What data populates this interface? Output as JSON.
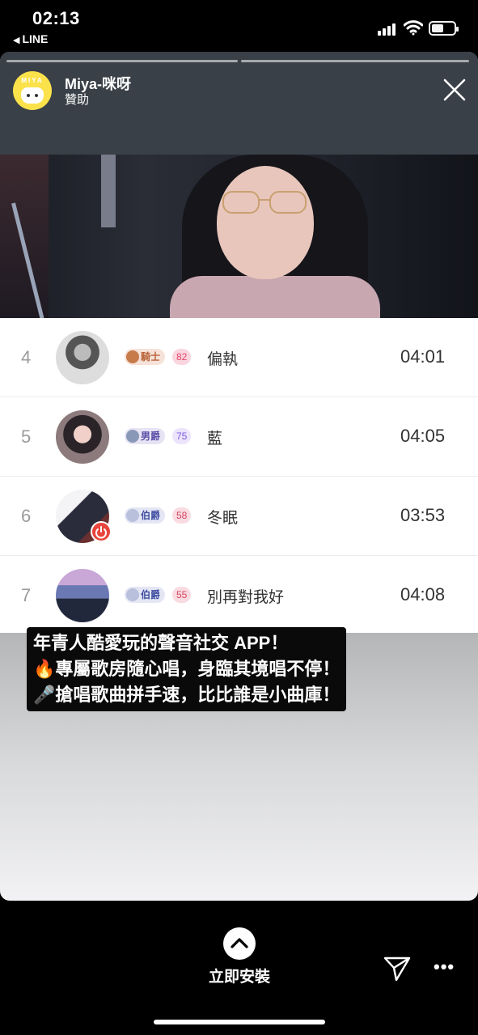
{
  "status_bar": {
    "time": "02:13",
    "back_app": "LINE"
  },
  "story": {
    "account_name": "Miya-咪呀",
    "sponsored": "贊助",
    "avatar_brand": "MIYA"
  },
  "songs": [
    {
      "rank": "4",
      "badge": "騎士",
      "level": "82",
      "title": "偏執",
      "duration": "04:01"
    },
    {
      "rank": "5",
      "badge": "男爵",
      "level": "75",
      "title": "藍",
      "duration": "04:05"
    },
    {
      "rank": "6",
      "badge": "伯爵",
      "level": "58",
      "title": "冬眠",
      "duration": "03:53"
    },
    {
      "rank": "7",
      "badge": "伯爵",
      "level": "55",
      "title": "別再對我好",
      "duration": "04:08"
    }
  ],
  "promo": {
    "line1": "年青人酷愛玩的聲音社交 APP！",
    "line2": "🔥專屬歌房隨心唱，身臨其境唱不停！",
    "line3": "🎤搶唱歌曲拼手速，比比誰是小曲庫！"
  },
  "cta": {
    "install_label": "立即安裝"
  },
  "colors": {
    "header_bg": "#3a4048",
    "badge_pink": "#e8456a",
    "badge_purple": "#7b5ce0"
  },
  "icons": [
    "back-triangle-icon",
    "signal-icon",
    "wifi-icon",
    "battery-icon",
    "close-icon",
    "chevron-up-icon",
    "send-icon",
    "more-icon"
  ]
}
